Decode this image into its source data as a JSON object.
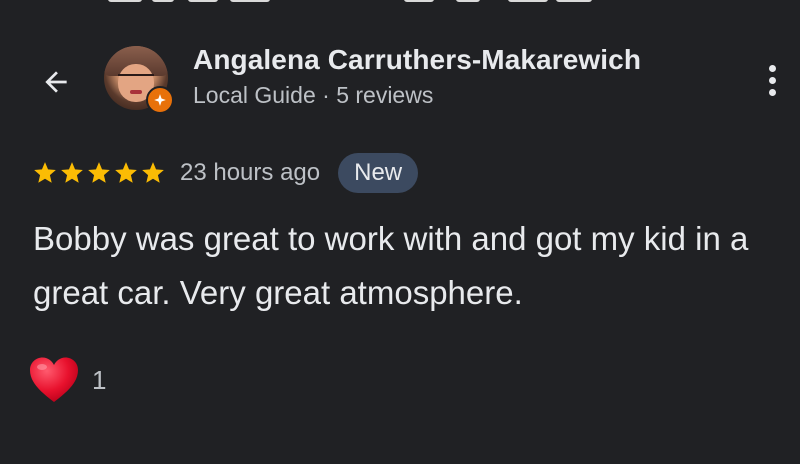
{
  "reviewer": {
    "name": "Angalena Carruthers-Makarewich",
    "subtitle": "Local Guide · 5 reviews",
    "avatar_icon": "avatar-photo",
    "badge_icon": "local-guide-star-badge"
  },
  "review": {
    "rating": 5,
    "rating_max": 5,
    "time": "23 hours ago",
    "badge": "New",
    "text": "Bobby was great to work with and got my kid in a great car. Very great atmosphere."
  },
  "reactions": {
    "icon": "heart-icon",
    "count": "1"
  },
  "icons": {
    "back": "back-arrow-icon",
    "more": "more-vertical-icon",
    "star": "star-icon"
  },
  "colors": {
    "background": "#202124",
    "star": "#fbbc04",
    "new_badge_bg": "#3c4a60",
    "guide_badge": "#e8710a",
    "heart": "#e8112d"
  }
}
